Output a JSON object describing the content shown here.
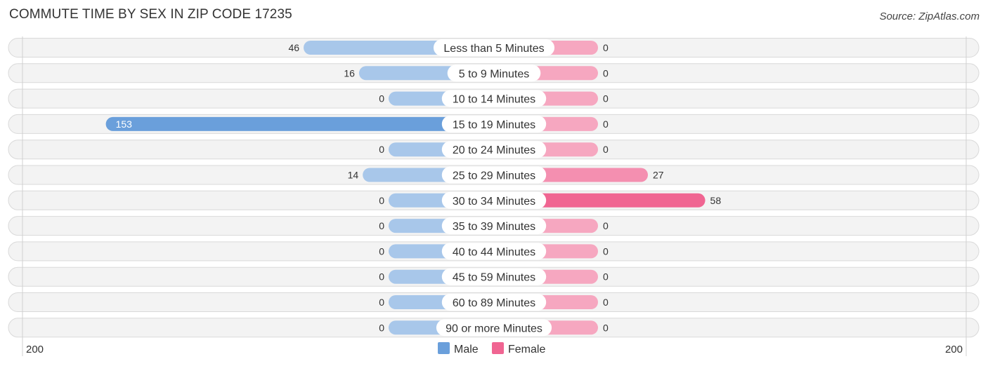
{
  "header": {
    "title": "COMMUTE TIME BY SEX IN ZIP CODE 17235",
    "source": "Source: ZipAtlas.com"
  },
  "colors": {
    "male_strong": "#6a9fdb",
    "male_light": "#a8c7ea",
    "female_strong": "#f06592",
    "female_light": "#f6a7c0",
    "row_bg": "#f3f3f3"
  },
  "chart_data": {
    "type": "bar",
    "orientation": "horizontal-diverging",
    "title": "COMMUTE TIME BY SEX IN ZIP CODE 17235",
    "categories": [
      "Less than 5 Minutes",
      "5 to 9 Minutes",
      "10 to 14 Minutes",
      "15 to 19 Minutes",
      "20 to 24 Minutes",
      "25 to 29 Minutes",
      "30 to 34 Minutes",
      "35 to 39 Minutes",
      "40 to 44 Minutes",
      "45 to 59 Minutes",
      "60 to 89 Minutes",
      "90 or more Minutes"
    ],
    "series": [
      {
        "name": "Male",
        "side": "left",
        "values": [
          46,
          16,
          0,
          153,
          0,
          14,
          0,
          0,
          0,
          0,
          0,
          0
        ]
      },
      {
        "name": "Female",
        "side": "right",
        "values": [
          0,
          0,
          0,
          0,
          0,
          27,
          58,
          0,
          0,
          0,
          0,
          0
        ]
      }
    ],
    "axis": {
      "left_label": "200",
      "right_label": "200",
      "max": 200
    },
    "legend": {
      "position": "bottom-center",
      "items": [
        "Male",
        "Female"
      ]
    },
    "grid": false
  }
}
